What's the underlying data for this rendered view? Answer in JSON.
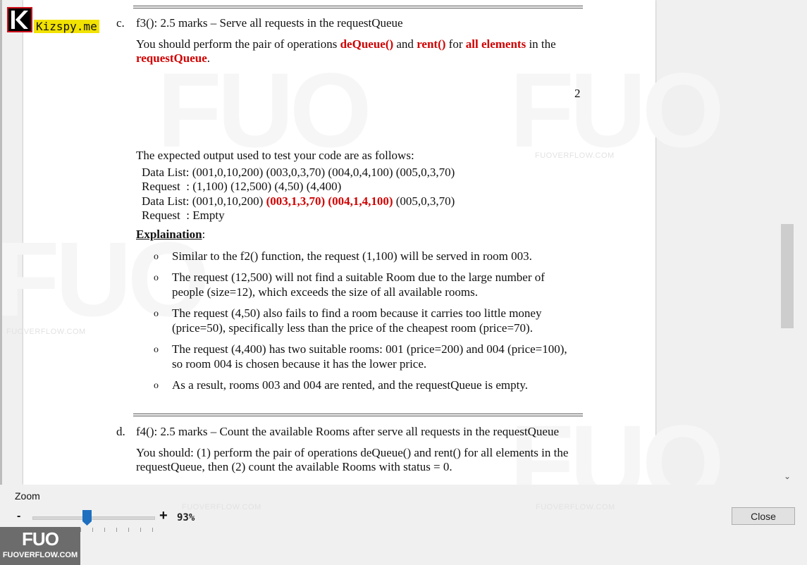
{
  "app": {
    "kizspy_label": "Kizspy.me",
    "fuo_badge_logo": "FUO",
    "fuo_badge_site": "FUOVERFLOW.COM",
    "watermark_text": "FUOVERFLOW.COM",
    "watermark_logo": "FUO"
  },
  "document": {
    "item_c_marker": "c.",
    "item_c_title": "f3(): 2.5 marks – Serve all requests in the requestQueue",
    "item_c_line1_a": "You should perform the pair of operations ",
    "item_c_line1_b": "deQueue()",
    "item_c_line1_c": " and ",
    "item_c_line1_d": "rent()",
    "item_c_line1_e": " for ",
    "item_c_line1_f": "all elements",
    "item_c_line1_g": " in the",
    "item_c_line2": "requestQueue",
    "item_c_line2_end": ".",
    "page_number": "2",
    "expected_intro": "The expected output used to test your code are as follows:",
    "out1": "Data List: (001,0,10,200) (003,0,3,70) (004,0,4,100) (005,0,3,70)",
    "out2": "Request  : (1,100) (12,500) (4,50) (4,400)",
    "out3_a": "Data List: (001,0,10,200) ",
    "out3_b": "(003,1,3,70) (004,1,4,100)",
    "out3_c": " (005,0,3,70)",
    "out4": "Request  : Empty",
    "explain_heading": "Explaination",
    "explain_colon": ":",
    "bullets": [
      {
        "l1": "Similar to the f2() function, the request (1,100) will be served in room 003.",
        "l2": ""
      },
      {
        "l1": "The request (12,500) will not find a suitable Room due to the large number of",
        "l2": "people (size=12), which exceeds the size of all available rooms."
      },
      {
        "l1": "The request (4,50) also fails to find a room because it carries too little money",
        "l2": "(price=50), specifically less than the price of the cheapest room (price=70)."
      },
      {
        "l1": "The request (4,400) has two suitable rooms: 001 (price=200) and 004 (price=100),",
        "l2": "so room 004 is chosen because it has the lower price."
      },
      {
        "l1": "As a result, rooms 003 and 004 are rented, and the requestQueue is empty.",
        "l2": ""
      }
    ],
    "bullet_glyph": "o",
    "item_d_marker": "d.",
    "item_d_title": "f4(): 2.5 marks – Count the available Rooms after serve all requests in the requestQueue",
    "item_d_line1": "You should: (1) perform the pair of operations deQueue() and rent() for all elements in the",
    "item_d_line2": "requestQueue, then (2) count the available Rooms with status = 0."
  },
  "zoom": {
    "label": "Zoom",
    "minus": "-",
    "plus": "+",
    "value_text": "93%",
    "level": 0.45
  },
  "buttons": {
    "close": "Close"
  },
  "colors": {
    "highlight_red": "#d00000",
    "slider_thumb": "#1e6fc0",
    "logo_red": "#d0101b",
    "kizspy_yellow": "#f2e200"
  }
}
